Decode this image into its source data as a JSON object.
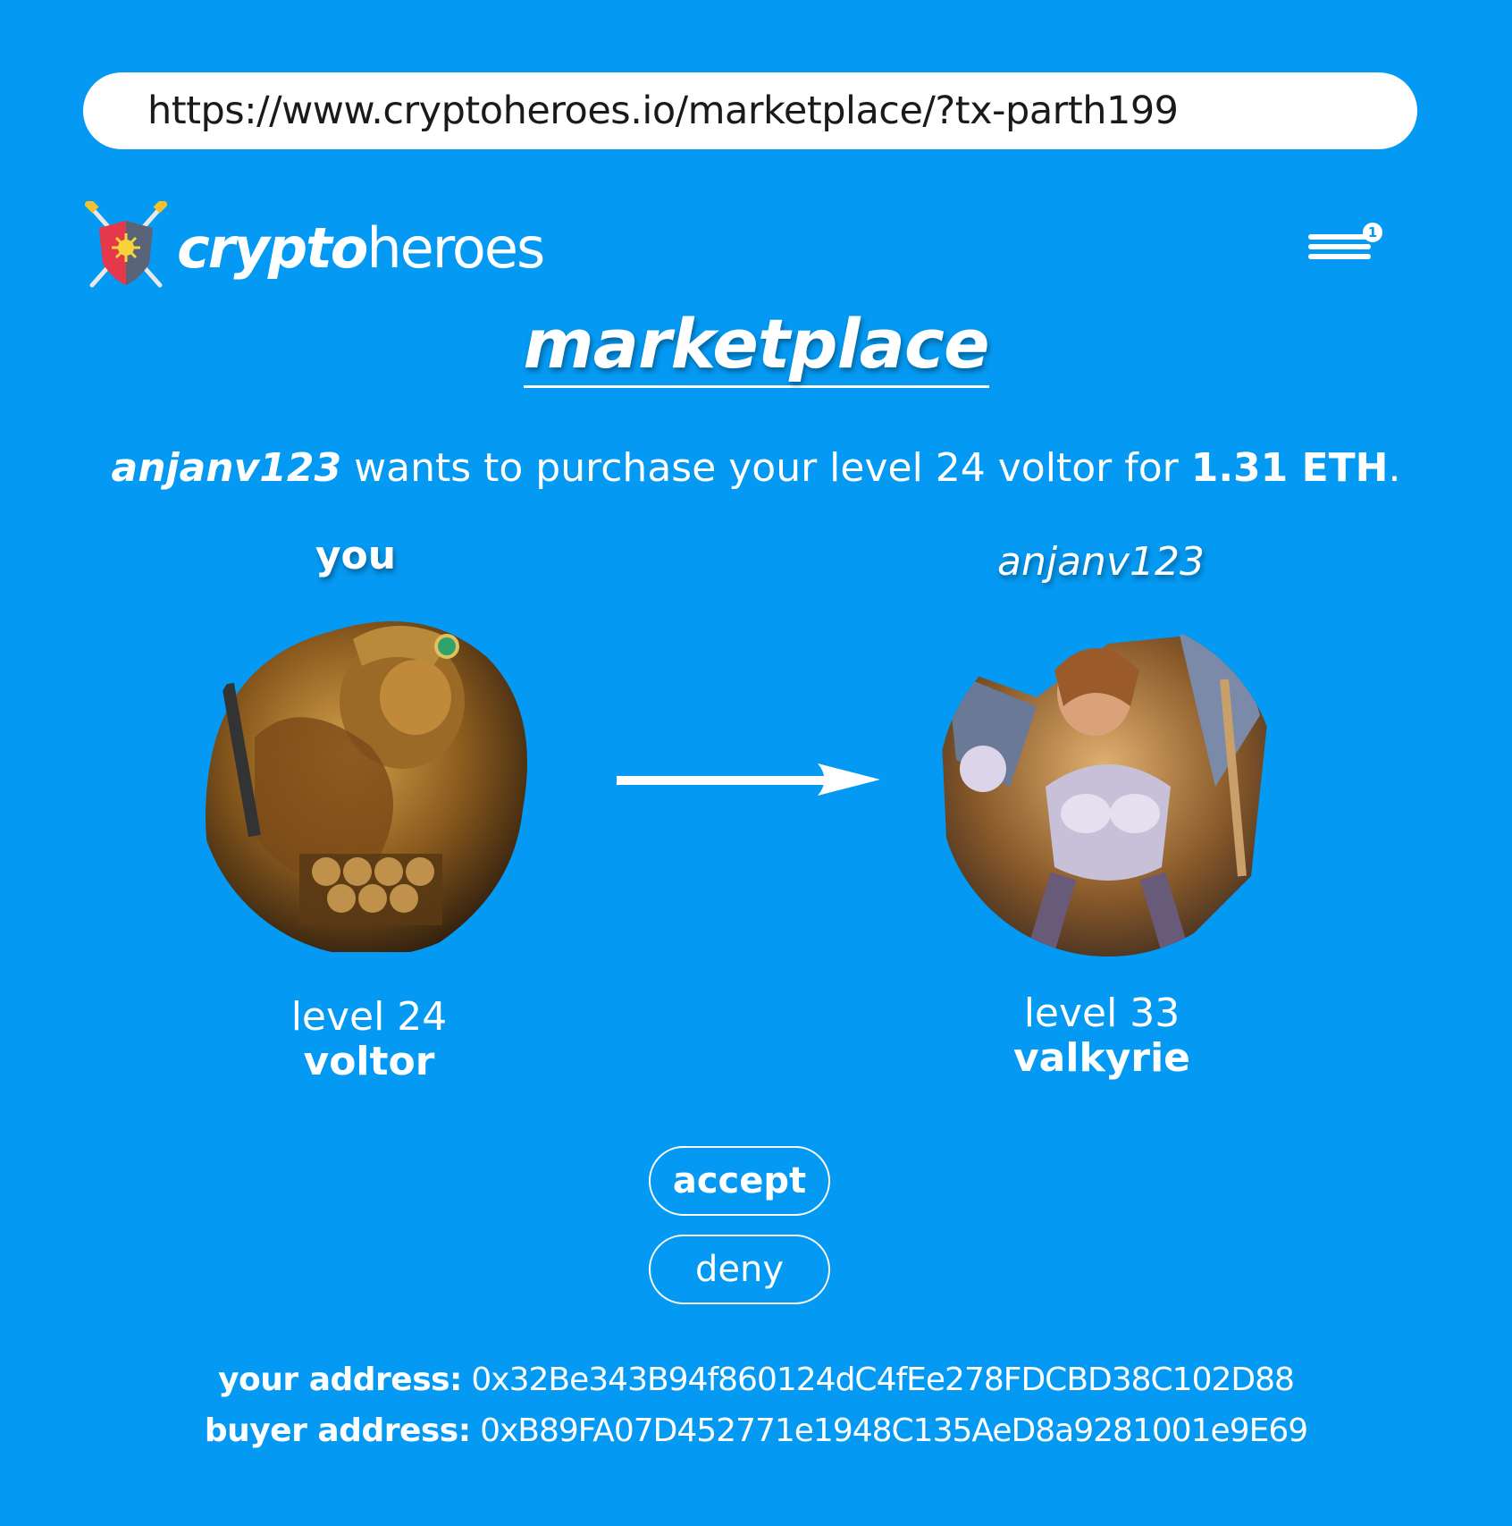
{
  "browser": {
    "url": "https://www.cryptoheroes.io/marketplace/?tx-parth199"
  },
  "brand": {
    "bold": "crypto",
    "light": "heroes",
    "logo_icon": "shield-swords-icon"
  },
  "menu": {
    "icon": "hamburger-menu-icon",
    "badge": "1"
  },
  "page": {
    "title": "marketplace"
  },
  "offer": {
    "buyer": "anjanv123",
    "text": " wants to purchase your level 24 voltor for ",
    "price": "1.31 ETH",
    "end": "."
  },
  "seller": {
    "label": "you",
    "level": "level 24",
    "hero": "voltor"
  },
  "buyer": {
    "label": "anjanv123",
    "level": "level 33",
    "hero": "valkyrie"
  },
  "actions": {
    "accept": "accept",
    "deny": "deny"
  },
  "addresses": {
    "your_label": "your address:",
    "your_value": " 0x32Be343B94f860124dC4fEe278FDCBD38C102D88",
    "buyer_label": "buyer address:",
    "buyer_value": " 0xB89FA07D452771e1948C135AeD8a928100‌1e9E69"
  },
  "colors": {
    "background": "#0499f2",
    "text": "#ffffff"
  }
}
